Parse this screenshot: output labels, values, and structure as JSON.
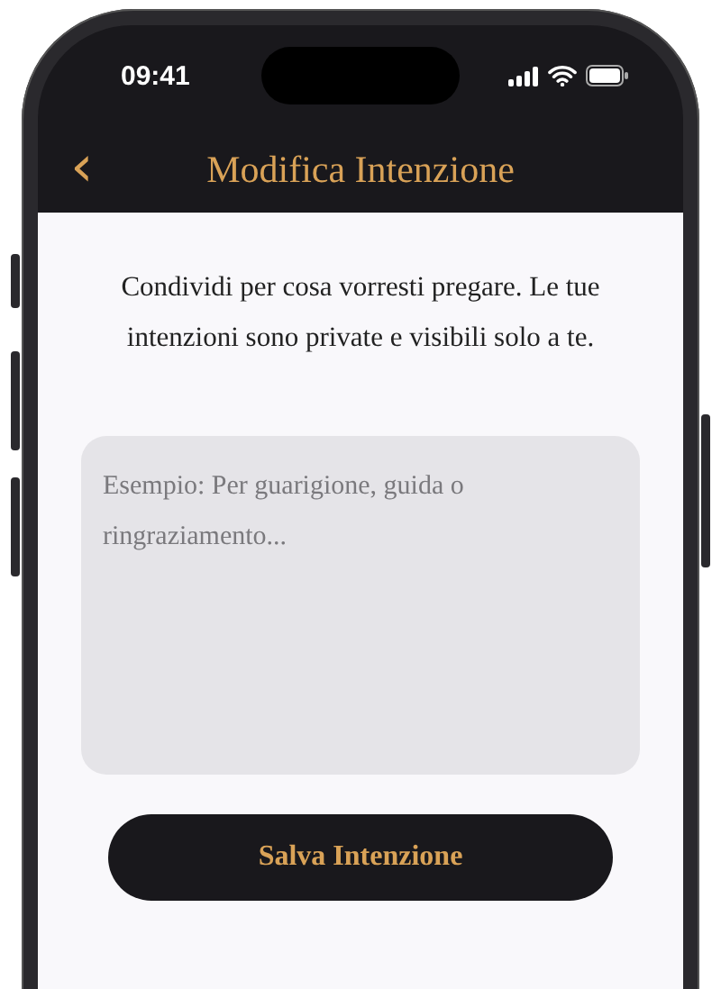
{
  "status_bar": {
    "time": "09:41"
  },
  "header": {
    "back_icon": "‹",
    "title": "Modifica Intenzione"
  },
  "description": "Condividi per cosa vorresti pregare. Le tue intenzioni sono private e visibili solo a te.",
  "intention_field": {
    "placeholder": "Esempio: Per guarigione, guida o ringraziamento..."
  },
  "buttons": [
    "Salva Intenzione"
  ]
}
